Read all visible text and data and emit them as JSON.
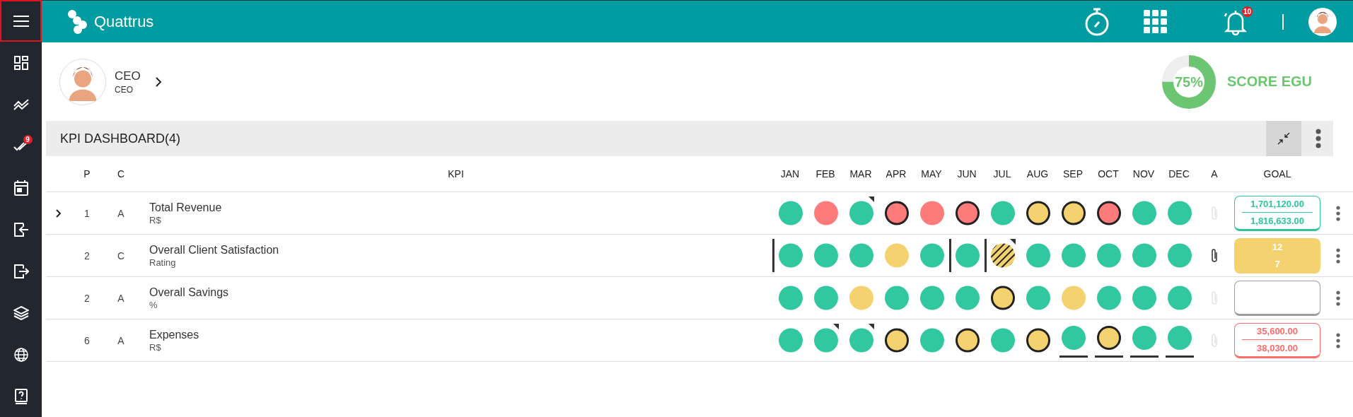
{
  "sidebar": {
    "items": [
      {
        "kind": "menu",
        "selected": true
      },
      {
        "kind": "dashboard",
        "selected": false
      },
      {
        "kind": "trend",
        "selected": false
      },
      {
        "kind": "tasks",
        "selected": false,
        "badge": "9"
      },
      {
        "kind": "calendar",
        "selected": false
      },
      {
        "kind": "login",
        "selected": false
      },
      {
        "kind": "logout",
        "selected": false
      },
      {
        "kind": "layers",
        "selected": false
      },
      {
        "kind": "globe",
        "selected": false
      },
      {
        "kind": "help",
        "selected": false
      }
    ]
  },
  "header": {
    "brand": "Quattrus",
    "notifications_badge": "10"
  },
  "profile": {
    "name": "CEO",
    "role": "CEO"
  },
  "score": {
    "level": 0.75,
    "value": "75%",
    "label": "SCORE EGU"
  },
  "dashboard": {
    "title": "KPI DASHBOARD(4)",
    "columns": [
      "P",
      "C",
      "KPI",
      "JAN",
      "FEB",
      "MAR",
      "APR",
      "MAY",
      "JUN",
      "JUL",
      "AUG",
      "SEP",
      "OCT",
      "NOV",
      "DEC",
      "A",
      "GOAL"
    ],
    "rows": [
      {
        "expandable": true,
        "p": "1",
        "c": "A",
        "kpi": "Total Revenue",
        "unit": "R$",
        "attachment": false,
        "goal": {
          "color": "#2ec59e",
          "filled": false,
          "values": [
            "1,701,120.00",
            "1,816,633.00"
          ]
        },
        "months": [
          {
            "color": "#31c7a0",
            "outlined": false,
            "flagged": false,
            "hatched": false,
            "left_bar": false,
            "underline": false
          },
          {
            "color": "#fe7b7b",
            "outlined": false,
            "flagged": false,
            "hatched": false,
            "left_bar": false,
            "underline": false
          },
          {
            "color": "#31c7a0",
            "outlined": false,
            "flagged": true,
            "hatched": false,
            "left_bar": false,
            "underline": false
          },
          {
            "color": "#fe7b7b",
            "outlined": true,
            "flagged": false,
            "hatched": false,
            "left_bar": false,
            "underline": false
          },
          {
            "color": "#fe7b7b",
            "outlined": false,
            "flagged": false,
            "hatched": false,
            "left_bar": false,
            "underline": false
          },
          {
            "color": "#fe7b7b",
            "outlined": true,
            "flagged": false,
            "hatched": false,
            "left_bar": false,
            "underline": false
          },
          {
            "color": "#31c7a0",
            "outlined": false,
            "flagged": false,
            "hatched": false,
            "left_bar": false,
            "underline": false
          },
          {
            "color": "#f4d26f",
            "outlined": true,
            "flagged": false,
            "hatched": false,
            "left_bar": false,
            "underline": false
          },
          {
            "color": "#f4d26f",
            "outlined": true,
            "flagged": false,
            "hatched": false,
            "left_bar": false,
            "underline": false
          },
          {
            "color": "#fe7b7b",
            "outlined": true,
            "flagged": false,
            "hatched": false,
            "left_bar": false,
            "underline": false
          },
          {
            "color": "#31c7a0",
            "outlined": false,
            "flagged": false,
            "hatched": false,
            "left_bar": false,
            "underline": false
          },
          {
            "color": "#31c7a0",
            "outlined": false,
            "flagged": false,
            "hatched": false,
            "left_bar": false,
            "underline": false
          }
        ]
      },
      {
        "expandable": false,
        "p": "2",
        "c": "C",
        "kpi": "Overall Client Satisfaction",
        "unit": "Rating",
        "attachment": true,
        "goal": {
          "color": "#f4d26f",
          "filled": true,
          "values": [
            "12",
            "7"
          ]
        },
        "months": [
          {
            "color": "#31c7a0",
            "outlined": false,
            "flagged": false,
            "hatched": false,
            "left_bar": true,
            "underline": false
          },
          {
            "color": "#31c7a0",
            "outlined": false,
            "flagged": false,
            "hatched": false,
            "left_bar": false,
            "underline": false
          },
          {
            "color": "#31c7a0",
            "outlined": false,
            "flagged": false,
            "hatched": false,
            "left_bar": false,
            "underline": false
          },
          {
            "color": "#f4d26f",
            "outlined": false,
            "flagged": false,
            "hatched": false,
            "left_bar": false,
            "underline": false
          },
          {
            "color": "#31c7a0",
            "outlined": false,
            "flagged": false,
            "hatched": false,
            "left_bar": false,
            "underline": false
          },
          {
            "color": "#31c7a0",
            "outlined": false,
            "flagged": false,
            "hatched": false,
            "left_bar": true,
            "underline": false
          },
          {
            "color": "#f4d26f",
            "outlined": false,
            "flagged": true,
            "hatched": true,
            "left_bar": true,
            "underline": false
          },
          {
            "color": "#31c7a0",
            "outlined": false,
            "flagged": false,
            "hatched": false,
            "left_bar": false,
            "underline": false
          },
          {
            "color": "#31c7a0",
            "outlined": false,
            "flagged": false,
            "hatched": false,
            "left_bar": false,
            "underline": false
          },
          {
            "color": "#31c7a0",
            "outlined": false,
            "flagged": false,
            "hatched": false,
            "left_bar": false,
            "underline": false
          },
          {
            "color": "#31c7a0",
            "outlined": false,
            "flagged": false,
            "hatched": false,
            "left_bar": false,
            "underline": false
          },
          {
            "color": "#31c7a0",
            "outlined": false,
            "flagged": false,
            "hatched": false,
            "left_bar": false,
            "underline": false
          }
        ]
      },
      {
        "expandable": false,
        "p": "2",
        "c": "A",
        "kpi": "Overall Savings",
        "unit": "%",
        "attachment": false,
        "goal": {
          "color": "#9e9e9e",
          "filled": false
        },
        "months": [
          {
            "color": "#31c7a0",
            "outlined": false,
            "flagged": false,
            "hatched": false,
            "left_bar": false,
            "underline": false
          },
          {
            "color": "#31c7a0",
            "outlined": false,
            "flagged": false,
            "hatched": false,
            "left_bar": false,
            "underline": false
          },
          {
            "color": "#f4d26f",
            "outlined": false,
            "flagged": false,
            "hatched": false,
            "left_bar": false,
            "underline": false
          },
          {
            "color": "#31c7a0",
            "outlined": false,
            "flagged": false,
            "hatched": false,
            "left_bar": false,
            "underline": false
          },
          {
            "color": "#31c7a0",
            "outlined": false,
            "flagged": false,
            "hatched": false,
            "left_bar": false,
            "underline": false
          },
          {
            "color": "#31c7a0",
            "outlined": false,
            "flagged": false,
            "hatched": false,
            "left_bar": false,
            "underline": false
          },
          {
            "color": "#f4d26f",
            "outlined": true,
            "flagged": false,
            "hatched": false,
            "left_bar": false,
            "underline": false
          },
          {
            "color": "#31c7a0",
            "outlined": false,
            "flagged": false,
            "hatched": false,
            "left_bar": false,
            "underline": false
          },
          {
            "color": "#f4d26f",
            "outlined": false,
            "flagged": false,
            "hatched": false,
            "left_bar": false,
            "underline": false
          },
          {
            "color": "#31c7a0",
            "outlined": false,
            "flagged": false,
            "hatched": false,
            "left_bar": false,
            "underline": false
          },
          {
            "color": "#31c7a0",
            "outlined": false,
            "flagged": false,
            "hatched": false,
            "left_bar": false,
            "underline": false
          },
          {
            "color": "#31c7a0",
            "outlined": false,
            "flagged": false,
            "hatched": false,
            "left_bar": false,
            "underline": false
          }
        ]
      },
      {
        "expandable": false,
        "p": "6",
        "c": "A",
        "kpi": "Expenses",
        "unit": "R$",
        "attachment": false,
        "goal": {
          "color": "#fe6b6b",
          "filled": false,
          "values": [
            "35,600.00",
            "38,030.00"
          ]
        },
        "months": [
          {
            "color": "#31c7a0",
            "outlined": false,
            "flagged": false,
            "hatched": false,
            "left_bar": false,
            "underline": false
          },
          {
            "color": "#31c7a0",
            "outlined": false,
            "flagged": true,
            "hatched": false,
            "left_bar": false,
            "underline": false
          },
          {
            "color": "#31c7a0",
            "outlined": false,
            "flagged": true,
            "hatched": false,
            "left_bar": false,
            "underline": false
          },
          {
            "color": "#f4d26f",
            "outlined": true,
            "flagged": false,
            "hatched": false,
            "left_bar": false,
            "underline": false
          },
          {
            "color": "#31c7a0",
            "outlined": false,
            "flagged": false,
            "hatched": false,
            "left_bar": false,
            "underline": false
          },
          {
            "color": "#f4d26f",
            "outlined": true,
            "flagged": false,
            "hatched": false,
            "left_bar": false,
            "underline": false
          },
          {
            "color": "#31c7a0",
            "outlined": false,
            "flagged": false,
            "hatched": false,
            "left_bar": false,
            "underline": false
          },
          {
            "color": "#f4d26f",
            "outlined": true,
            "flagged": false,
            "hatched": false,
            "left_bar": false,
            "underline": false
          },
          {
            "color": "#31c7a0",
            "outlined": false,
            "flagged": false,
            "hatched": false,
            "left_bar": false,
            "underline": true
          },
          {
            "color": "#f4d26f",
            "outlined": true,
            "flagged": false,
            "hatched": false,
            "left_bar": false,
            "underline": true
          },
          {
            "color": "#31c7a0",
            "outlined": false,
            "flagged": false,
            "hatched": false,
            "left_bar": false,
            "underline": true
          },
          {
            "color": "#31c7a0",
            "outlined": false,
            "flagged": false,
            "hatched": false,
            "left_bar": false,
            "underline": true
          }
        ]
      }
    ]
  }
}
